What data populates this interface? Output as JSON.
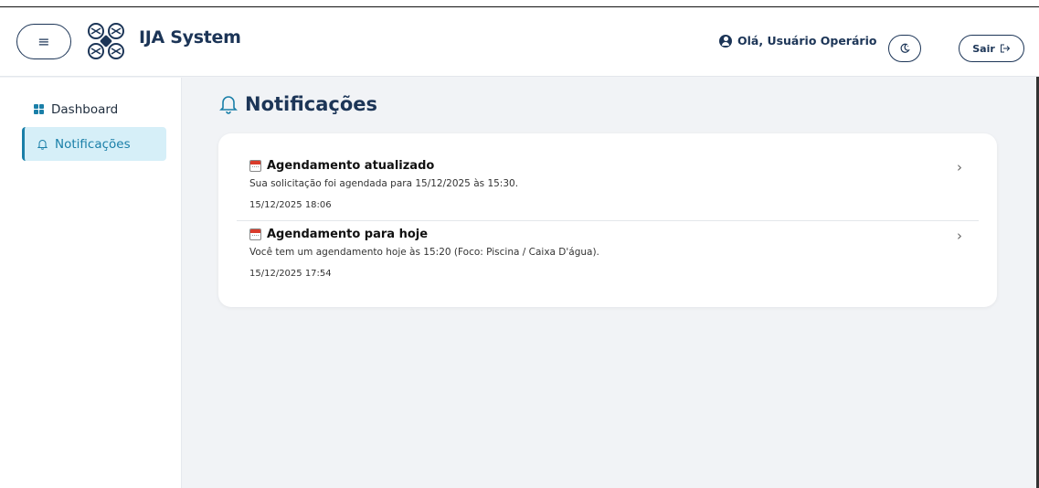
{
  "header": {
    "brand": "IJA System",
    "menu_icon": "hamburger-icon",
    "logo_icon": "drone-icon",
    "greeting": "Olá, Usuário Operário",
    "theme_icon": "moon-icon",
    "logout_label": "Sair",
    "logout_icon": "logout-icon"
  },
  "sidebar": {
    "items": [
      {
        "label": "Dashboard",
        "icon": "grid-icon",
        "active": false
      },
      {
        "label": "Notificações",
        "icon": "bell-icon",
        "active": true
      }
    ]
  },
  "main": {
    "title": "Notificações",
    "title_icon": "bell-icon",
    "notifications": [
      {
        "title": "Agendamento atualizado",
        "message": "Sua solicitação foi agendada para 15/12/2025 às 15:30.",
        "date": "15/12/2025 18:06"
      },
      {
        "title": "Agendamento para hoje",
        "message": "Você tem um agendamento hoje às 15:20 (Foco: Piscina / Caixa D'água).",
        "date": "15/12/2025 17:54"
      }
    ]
  },
  "colors": {
    "primary": "#1c3557",
    "accent": "#1a7fa8",
    "active_bg": "#d6eff8",
    "page_bg": "#f1f3f6"
  }
}
